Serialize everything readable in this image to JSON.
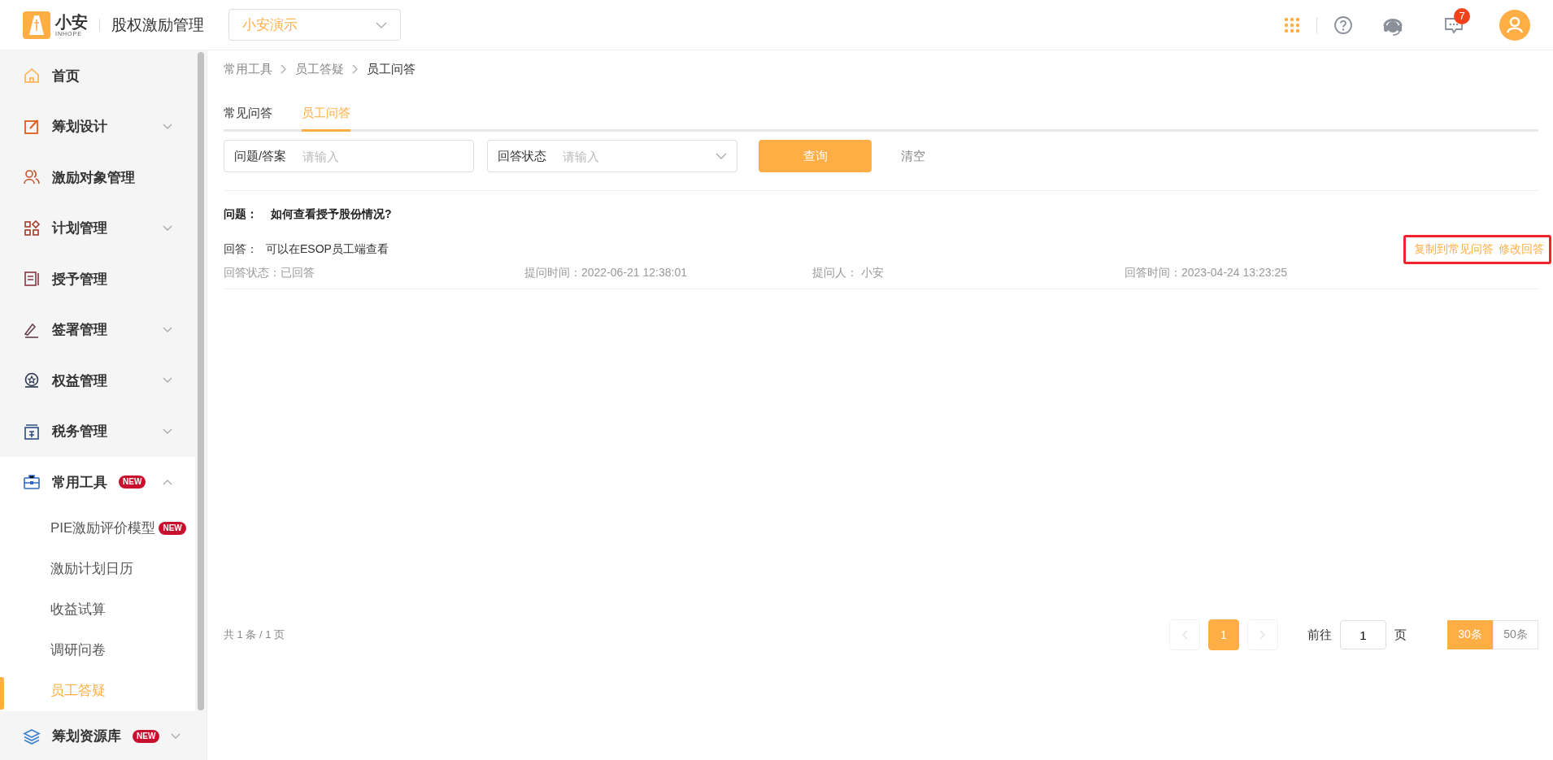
{
  "header": {
    "logo": {
      "name": "小安",
      "sub": "INHOPE"
    },
    "app_title": "股权激励管理",
    "company_select": {
      "value": "小安演示"
    },
    "message_badge": "7"
  },
  "sidebar": {
    "items": [
      {
        "label": "首页"
      },
      {
        "label": "筹划设计",
        "expanded": false
      },
      {
        "label": "激励对象管理"
      },
      {
        "label": "计划管理",
        "expanded": false
      },
      {
        "label": "授予管理"
      },
      {
        "label": "签署管理",
        "expanded": false
      },
      {
        "label": "权益管理",
        "expanded": false
      },
      {
        "label": "税务管理",
        "expanded": false
      },
      {
        "label": "常用工具",
        "badge": "NEW",
        "expanded": true,
        "children": [
          {
            "label": "PIE激励评价模型",
            "badge": "NEW",
            "selected": false
          },
          {
            "label": "激励计划日历",
            "selected": false
          },
          {
            "label": "收益试算",
            "selected": false
          },
          {
            "label": "调研问卷",
            "selected": false
          },
          {
            "label": "员工答疑",
            "selected": true
          }
        ]
      },
      {
        "label": "筹划资源库",
        "badge": "NEW",
        "expanded": false
      }
    ]
  },
  "breadcrumb": [
    "常用工具",
    "员工答疑",
    "员工问答"
  ],
  "tabs": [
    {
      "label": "常见问答",
      "selected": false
    },
    {
      "label": "员工问答",
      "selected": true
    }
  ],
  "filters": [
    {
      "kind": "input",
      "label": "问题/答案",
      "placeholder": "请输入"
    },
    {
      "kind": "select",
      "label": "回答状态",
      "placeholder": "请输入"
    }
  ],
  "buttons": {
    "query": "查询",
    "clear": "清空"
  },
  "records": [
    {
      "question_label": "问题：",
      "question": "如何查看授予股份情况?",
      "answer_label": "回答：",
      "answer": "可以在ESOP员工端查看",
      "actions": [
        "复制到常见问答",
        "修改回答"
      ],
      "highlighted": true,
      "meta": [
        {
          "label": "回答状态：",
          "value": "已回答"
        },
        {
          "label": "提问时间：",
          "value": "2022-06-21 12:38:01"
        },
        {
          "label": "提问人：",
          "value": "小安"
        },
        {
          "label": "回答时间：",
          "value": "2023-04-24 13:23:25"
        }
      ]
    }
  ],
  "pagination": {
    "total": "共 1 条 / 1 页",
    "prev_disabled": true,
    "next_disabled": true,
    "pages": [
      {
        "label": "1",
        "selected": true
      }
    ],
    "goto_label": "前往",
    "goto_value": "1",
    "goto_suffix": "页",
    "sizes": [
      {
        "label": "30条",
        "selected": true
      },
      {
        "label": "50条",
        "selected": false
      }
    ]
  }
}
